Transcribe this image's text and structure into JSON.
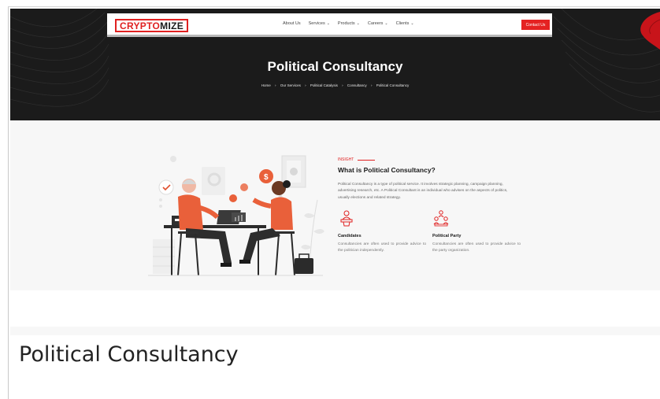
{
  "header": {
    "logo_part1": "CRYPTO",
    "logo_part2": "MIZE",
    "menu": [
      {
        "label": "About Us",
        "has_dropdown": false
      },
      {
        "label": "Services",
        "has_dropdown": true
      },
      {
        "label": "Products",
        "has_dropdown": true
      },
      {
        "label": "Careers",
        "has_dropdown": true
      },
      {
        "label": "Clients",
        "has_dropdown": true
      }
    ],
    "contact_label": "Contact Us"
  },
  "hero": {
    "title": "Political Consultancy",
    "breadcrumb": [
      "Home",
      "Our Services",
      "Political Catalysis",
      "Consultancy",
      "Political Consultancy"
    ],
    "separator": "›"
  },
  "content": {
    "eyebrow": "INSIGHT",
    "heading": "What is Political Consultancy?",
    "description": "Political Consultancy is a type of political service. It involves strategic planning, campaign planning, advertising research, etc. A Political Consultant is an individual who advises on the aspects of politics, usually elections and related strategy.",
    "features": [
      {
        "title": "Candidates",
        "text": "Consultancies are often used to provide advice to the politician independently.",
        "icon": "candidate-podium-icon"
      },
      {
        "title": "Political Party",
        "text": "Consultancies are often used to provide advice to the party organization.",
        "icon": "party-group-icon"
      }
    ]
  },
  "caption": "Political Consultancy",
  "colors": {
    "accent": "#e02020",
    "hero_bg": "#1b1b1b",
    "page_bg": "#f7f7f7"
  }
}
